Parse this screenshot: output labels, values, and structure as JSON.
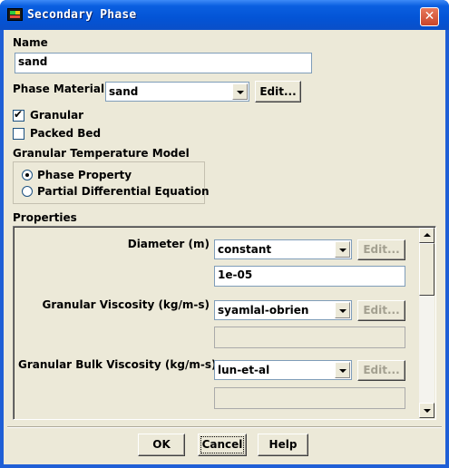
{
  "window": {
    "title": "Secondary Phase",
    "close_glyph": "✕"
  },
  "name": {
    "label": "Name",
    "value": "sand"
  },
  "phase_material": {
    "label": "Phase Material",
    "selected": "sand",
    "edit_label": "Edit..."
  },
  "options": {
    "granular": {
      "label": "Granular",
      "checked": true
    },
    "packed_bed": {
      "label": "Packed Bed",
      "checked": false
    }
  },
  "granular_temperature_model": {
    "label": "Granular Temperature Model",
    "options": [
      {
        "label": "Phase Property",
        "selected": true
      },
      {
        "label": "Partial Differential Equation",
        "selected": false
      }
    ]
  },
  "properties": {
    "label": "Properties",
    "rows": [
      {
        "label": "Diameter (m)",
        "method": "constant",
        "edit_label": "Edit...",
        "value": "1e-05"
      },
      {
        "label": "Granular Viscosity (kg/m-s)",
        "method": "syamlal-obrien",
        "edit_label": "Edit...",
        "value": ""
      },
      {
        "label": "Granular Bulk Viscosity (kg/m-s)",
        "method": "lun-et-al",
        "edit_label": "Edit...",
        "value": ""
      }
    ]
  },
  "footer": {
    "ok_label": "OK",
    "cancel_label": "Cancel",
    "help_label": "Help"
  },
  "colors": {
    "titlebar": "#0354d6",
    "dialog_bg": "#ece9d8",
    "close_button": "#c9452a"
  }
}
